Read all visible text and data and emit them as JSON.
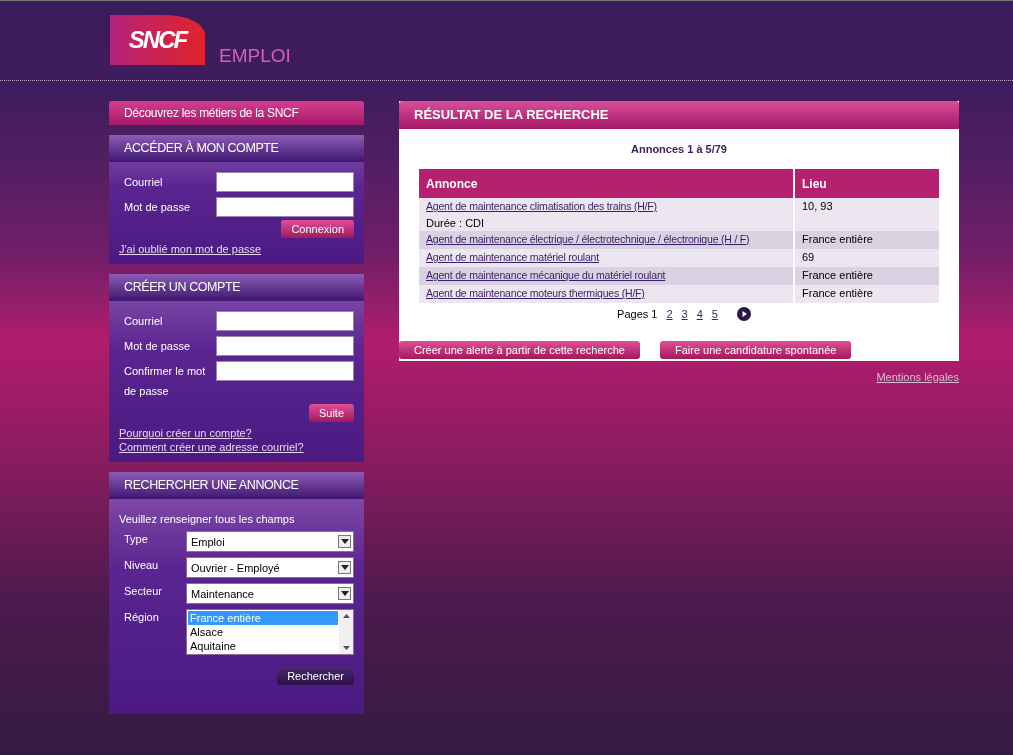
{
  "header": {
    "logo": "SNCF",
    "title": "EMPLOI"
  },
  "discover": {
    "label": "Découvrez les métiers de la SNCF"
  },
  "login": {
    "title": "ACCÉDER À MON COMPTE",
    "fields": [
      {
        "label": "Courriel"
      },
      {
        "label": "Mot de passe"
      }
    ],
    "button": "Connexion",
    "links": [
      "J'ai oublié mon mot de passe"
    ]
  },
  "register": {
    "title": "CRÉER UN COMPTE",
    "fields": [
      {
        "label": "Courriel"
      },
      {
        "label": "Mot de passe"
      },
      {
        "label": "Confirmer le mot de passe"
      }
    ],
    "button": "Suite",
    "links": [
      "Pourquoi créer un compte?",
      "Comment créer une adresse courriel?"
    ]
  },
  "search": {
    "title": "RECHERCHER UNE ANNONCE",
    "intro": "Veuillez renseigner tous les champs",
    "selects": [
      {
        "label": "Type",
        "value": "Emploi"
      },
      {
        "label": "Niveau",
        "value": "Ouvrier - Employé"
      },
      {
        "label": "Secteur",
        "value": "Maintenance"
      }
    ],
    "region": {
      "label": "Région",
      "options": [
        {
          "label": "France entière",
          "selected": true
        },
        {
          "label": "Alsace",
          "selected": false
        },
        {
          "label": "Aquitaine",
          "selected": false
        }
      ]
    },
    "button": "Rechercher"
  },
  "results": {
    "title": "RÉSULTAT DE LA RECHERCHE",
    "summary": "Annonces 1 à 5/79",
    "columns": [
      "Annonce",
      "Lieu"
    ],
    "rows": [
      {
        "title": "Agent de maintenance climatisation des trains (H/F)",
        "detail": "Durée : CDI",
        "place": "10, 93"
      },
      {
        "title": "Agent de maintenance électrique / électrotechnique / électronique (H / F)",
        "place": "France entière"
      },
      {
        "title": "Agent de maintenance matériel roulant",
        "place": "69"
      },
      {
        "title": "Agent de maintenance mécanique du matériel roulant",
        "place": "France entière"
      },
      {
        "title": "Agent de maintenance moteurs thermiques (H/F)",
        "place": "France entière"
      }
    ],
    "pages_label": "Pages",
    "pages": [
      {
        "label": "1",
        "selected": true
      },
      {
        "label": "2",
        "selected": false
      },
      {
        "label": "3",
        "selected": false
      },
      {
        "label": "4",
        "selected": false
      },
      {
        "label": "5",
        "selected": false
      }
    ],
    "buttons": [
      "Créer une alerte à partir de cette recherche",
      "Faire une candidature spontanée"
    ]
  },
  "footer": {
    "link": "Mentions légales"
  }
}
